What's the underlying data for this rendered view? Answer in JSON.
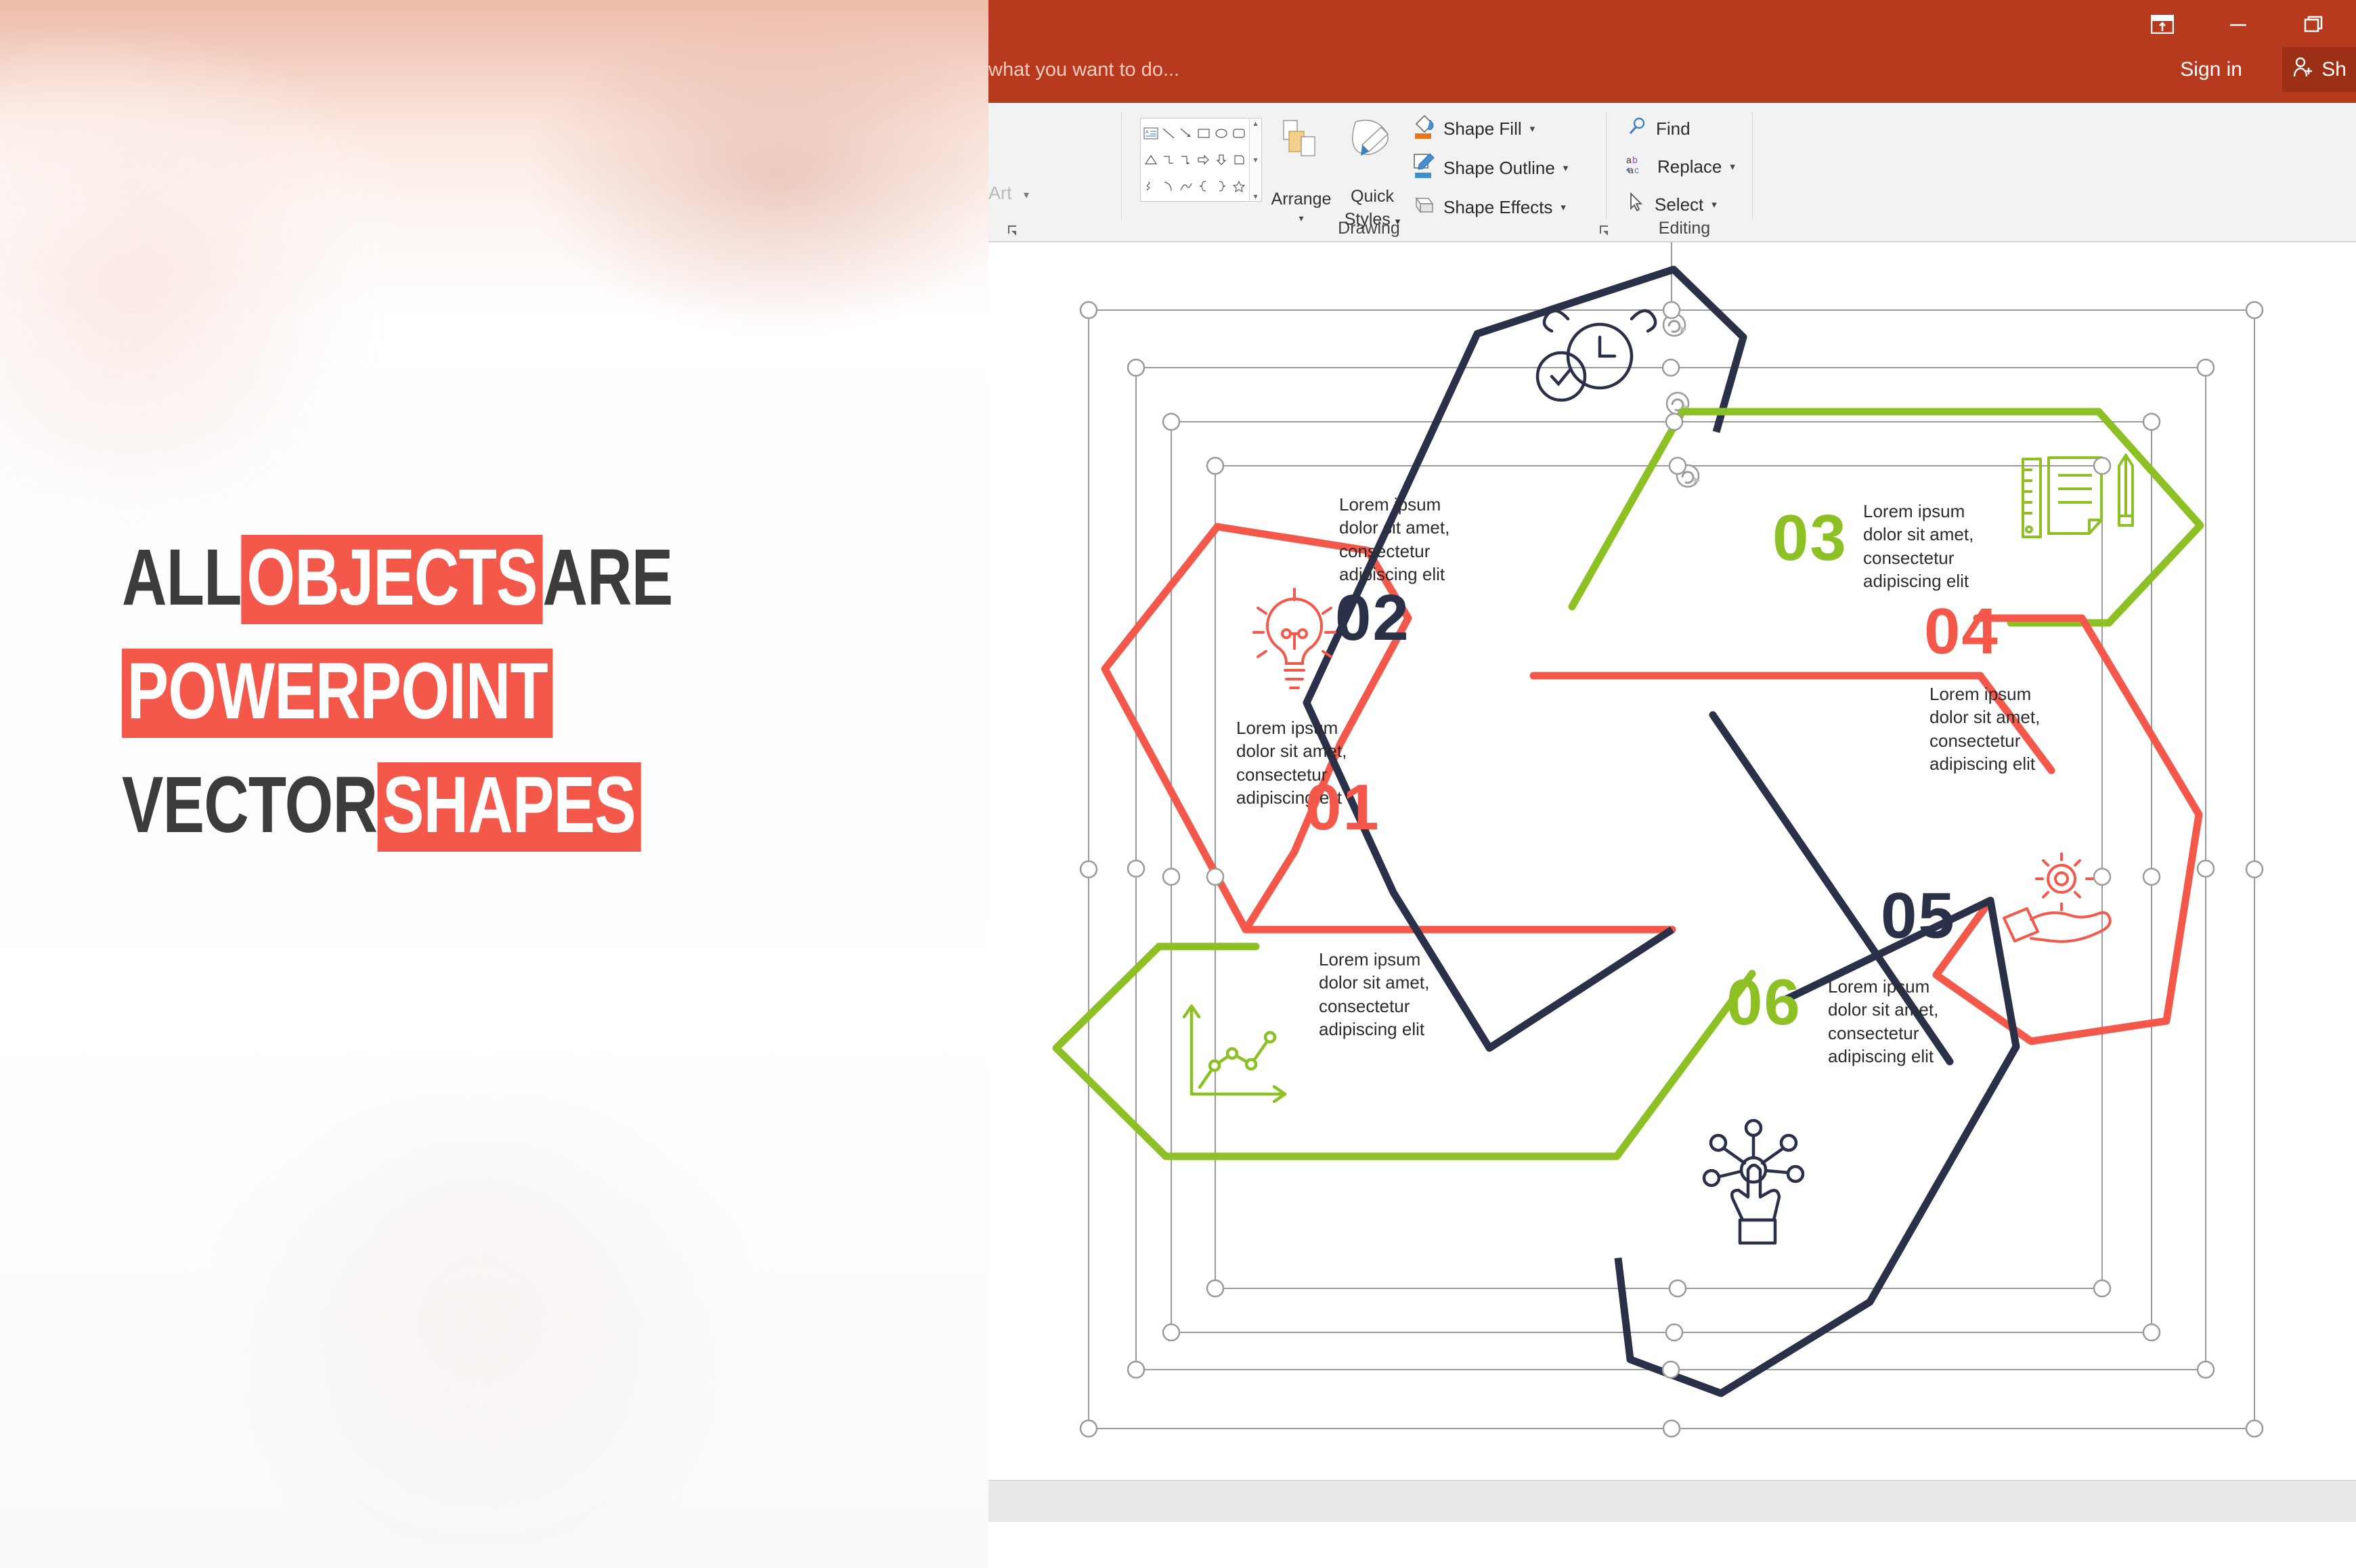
{
  "promo": {
    "line1": [
      {
        "text": "ALL ",
        "style": "plain"
      },
      {
        "text": "OBJECTS",
        "style": "highlight"
      },
      {
        "text": " ARE",
        "style": "plain"
      }
    ],
    "line2": [
      {
        "text": "POWERPOINT",
        "style": "highlight"
      }
    ],
    "line3": [
      {
        "text": "VECTOR ",
        "style": "plain"
      },
      {
        "text": "SHAPES",
        "style": "highlight"
      }
    ],
    "highlight_color": "#f4584b",
    "plain_color": "#3c3c3c"
  },
  "app": {
    "titlebar_color": "#b83a1e",
    "share_button_color": "#9d2f16",
    "tell_me_text": "what you want to do...",
    "sign_in_label": "Sign in",
    "share_label": "Sh",
    "window_controls": [
      {
        "name": "ribbon-display-options",
        "glyph": "ribbon"
      },
      {
        "name": "minimize",
        "glyph": "minimize"
      },
      {
        "name": "restore",
        "glyph": "restore"
      }
    ]
  },
  "ribbon": {
    "wordart_label": "Art",
    "groups": [
      {
        "name": "drawing",
        "caption": "Drawing"
      },
      {
        "name": "editing",
        "caption": "Editing"
      }
    ],
    "drawing": {
      "arrange_label": "Arrange",
      "quick_styles_line1": "Quick",
      "quick_styles_line2": "Styles",
      "commands": [
        {
          "label": "Shape Fill",
          "icon": "paint-bucket-icon",
          "swatch": "#e8761a",
          "has_caret": true
        },
        {
          "label": "Shape Outline",
          "icon": "pen-icon",
          "swatch": "#3f8ed0",
          "has_caret": true
        },
        {
          "label": "Shape Effects",
          "icon": "effects-icon",
          "swatch": "#d9d9d9",
          "has_caret": true
        }
      ],
      "shapes_gallery": [
        "textbox",
        "line",
        "line-arrow",
        "rectangle",
        "oval",
        "rounded-rectangle",
        "triangle",
        "elbow-connector",
        "elbow-arrow-connector",
        "right-arrow",
        "down-arrow",
        "pentagon-flag",
        "scribble",
        "curve",
        "freeform",
        "left-brace",
        "right-brace",
        "star"
      ]
    },
    "editing": {
      "commands": [
        {
          "label": "Find",
          "icon": "magnifier-icon",
          "has_caret": false
        },
        {
          "label": "Replace",
          "icon": "replace-abac-icon",
          "has_caret": true
        },
        {
          "label": "Select",
          "icon": "cursor-arrow-icon",
          "has_caret": true
        }
      ]
    }
  },
  "slide": {
    "palette": {
      "red": "#f4584b",
      "green": "#8cc024",
      "navy": "#2b3049",
      "handle": "#9a9a9a"
    },
    "body_text": "Lorem ipsum\ndolor sit amet,\nconsectetur\nadipiscing elit",
    "items": [
      {
        "number": "01",
        "color": "red",
        "icon": "lightbulb-icon",
        "text": "Lorem ipsum\ndolor sit amet,\nconsectetur\nadipiscing elit"
      },
      {
        "number": "02",
        "color": "navy",
        "icon": "alarm-clock-check-icon",
        "text": "Lorem ipsum\ndolor sit amet,\nconsectetur\nadipiscing elit"
      },
      {
        "number": "03",
        "color": "green",
        "icon": "ruler-notepad-pencil-icon",
        "text": "Lorem ipsum\ndolor sit amet,\nconsectetur\nadipiscing elit"
      },
      {
        "number": "04",
        "color": "red",
        "icon": "gear-in-hand-icon",
        "text": "Lorem ipsum\ndolor sit amet,\nconsectetur\nadipiscing elit"
      },
      {
        "number": "05",
        "color": "navy",
        "icon": "hand-click-network-icon",
        "text": "Lorem ipsum\ndolor sit amet,\nconsectetur\nadipiscing elit"
      },
      {
        "number": "06",
        "color": "green",
        "icon": "line-chart-icon",
        "text": "Lorem ipsum\ndolor sit amet,\nconsectetur\nadipiscing elit"
      }
    ]
  }
}
